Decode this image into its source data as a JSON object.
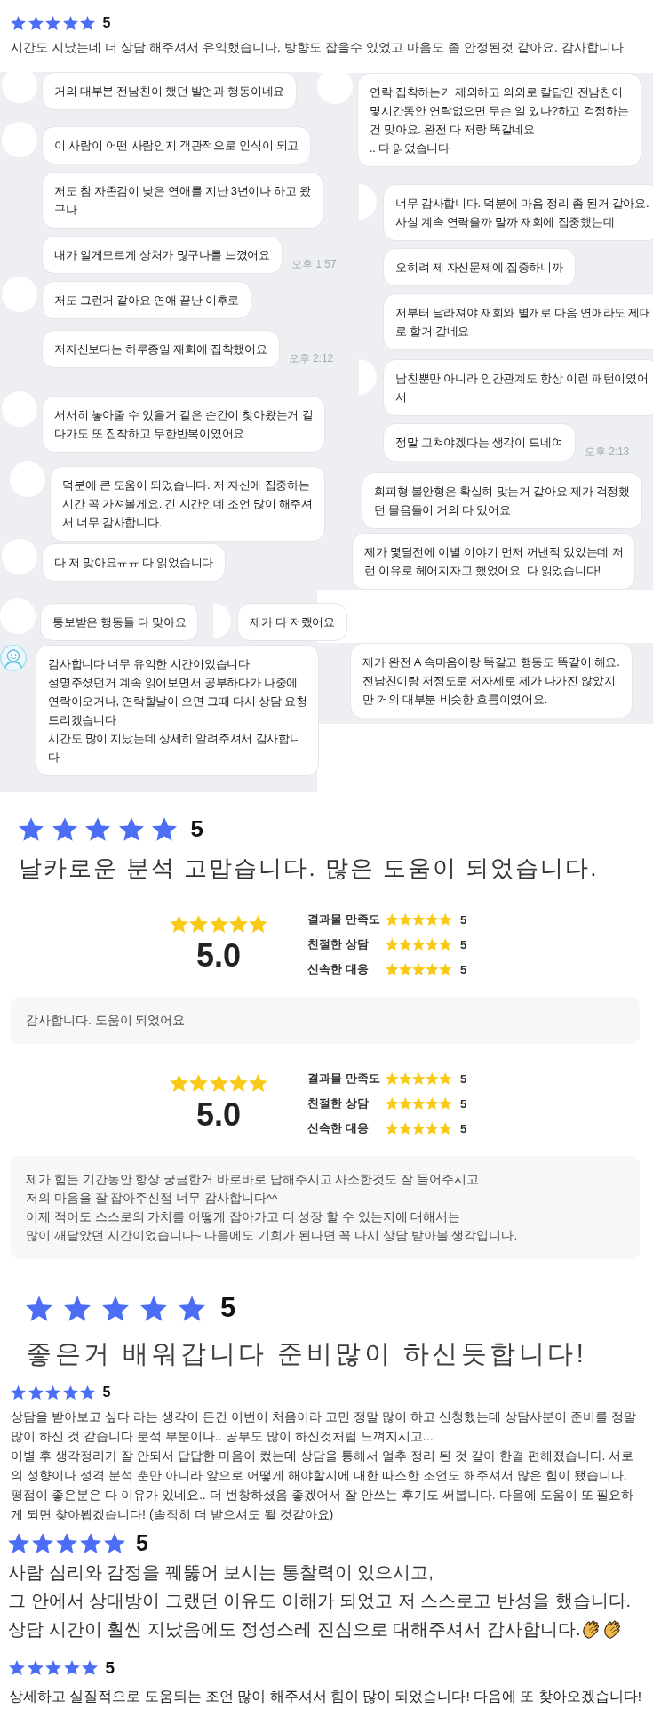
{
  "sections": [
    {
      "kind": "compact_review",
      "stars": 5,
      "score": "5",
      "text": "시간도 지났는데 더 상담 해주셔서 유익했습니다. 방향도 잡을수 있었고 마음도 좀 안정된것 같아요. 감사합니다"
    },
    {
      "kind": "chat_collage",
      "columns": [
        {
          "panels": [
            {
              "messages": [
                {
                  "kind": "avatar_message",
                  "text": "거의 대부분 전남친이 했던 발언과 행동이네요"
                },
                {
                  "kind": "avatar_message",
                  "text": "이 사람이 어떤 사람인지 객관적으로 인식이 되고"
                },
                {
                  "kind": "plain_message",
                  "text": "저도 참 자존감이 낮은 연애를 지난 3년이나 하고 왔\n구나"
                },
                {
                  "kind": "plain_message",
                  "text": "내가 알게모르게 상처가 많구나를 느꼈어요",
                  "time": "오후 1:57"
                },
                {
                  "kind": "avatar_message",
                  "text": "저도 그런거 같아요 연애 끝난 이후로"
                },
                {
                  "kind": "plain_message",
                  "text": "저자신보다는 하루종일 재회에 집착했어요",
                  "time": "오후 2:12"
                },
                {
                  "kind": "avatar_message",
                  "text": "서서히 놓아줄 수 있을거 같은 순간이 찾아왔는거 같\n다가도 또 집착하고 무한반복이였어요"
                },
                {
                  "kind": "avatar_message",
                  "text": "덕분에 큰 도움이 되었습니다. 저 자신에 집중하는\n시간 꼭 가져볼게요. 긴 시간인데 조언 많이 해주셔\n서 너무 감사합니다."
                },
                {
                  "kind": "avatar_message",
                  "text": "다 저 맞아요ㅠㅠ 다 읽었습니다"
                },
                {
                  "kind": "avatar_message",
                  "text": "통보받은 행동들 다 맞아요"
                },
                {
                  "kind": "cropped_avatar_message",
                  "text": "제가 다 저랬어요"
                },
                {
                  "kind": "profile_message",
                  "text": "감사합니다 너무 유익한 시간이었습니다\n설명주셨던거 계속 읽어보면서 공부하다가 나중에\n연락이오거나, 연락할날이 오면 그때 다시 상담 요청\n드리겠습니다\n시간도 많이 지났는데 상세히 알려주셔서 감사합니\n다"
                }
              ]
            }
          ]
        },
        {
          "panels": [
            {
              "messages": [
                {
                  "kind": "avatar_message",
                  "text": "연락 집착하는거 제외하고 의외로 칼답인 전남친이\n몇시간동안 연락없으면 무슨 일 있나?하고 걱정하는\n건 맞아요. 완전 다 저랑 똑같네요\n.. 다 읽었습니다"
                },
                {
                  "kind": "cropped_avatar_message",
                  "text": "너무 감사합니다. 덕분에 마음 정리 좀 된거 같아요.\n사실 계속 연락올까 말까 재회에 집중했는데"
                },
                {
                  "kind": "plain_message",
                  "text": "오히려 제 자신문제에 집중하니까"
                },
                {
                  "kind": "plain_message",
                  "text": "저부터 달라져야 재회와 별개로 다음 연애라도 제대\n로 할거 갈네요"
                },
                {
                  "kind": "cropped_avatar_message",
                  "text": "남친뿐만 아니라 인간관계도 항상 이런 패턴이였어\n서"
                },
                {
                  "kind": "plain_message",
                  "text": "정말 고쳐야겠다는 생각이 드네여",
                  "time": "오후 2:13"
                },
                {
                  "kind": "plain_message",
                  "text": "회피형 불안형은 확실히 맞는거 같아요 제가 걱정했\n던 물음들이 거의 다 있어요"
                },
                {
                  "kind": "plain_message",
                  "text": "제가 몇달전에 이별 이야기 먼저 꺼낸적 있었는데 저\n런 이유로 헤어지자고 했었어요. 다 읽었습니다!"
                }
              ]
            },
            {
              "messages": [
                {
                  "kind": "plain_message",
                  "text": "제가 완전 A 속마음이랑 똑같고 행동도 똑같이 해요.\n전남친이랑 저정도로 저자세로 제가 나가진 않았지\n만 거의 대부분 비슷한 흐름이였어요."
                }
              ]
            }
          ]
        }
      ]
    },
    {
      "kind": "headline_review",
      "stars": 5,
      "score": "5",
      "text": "날카로운 분석 고맙습니다. 많은 도움이 되었습니다."
    },
    {
      "kind": "rating_card",
      "stars": 5,
      "score": "5.0",
      "criteria": [
        {
          "label": "결과물 만족도",
          "stars": 5,
          "score": "5"
        },
        {
          "label": "친절한 상담",
          "stars": 5,
          "score": "5"
        },
        {
          "label": "신속한 대응",
          "stars": 5,
          "score": "5"
        }
      ],
      "comment": "감사합니다. 도움이 되었어요"
    },
    {
      "kind": "rating_card",
      "stars": 5,
      "score": "5.0",
      "criteria": [
        {
          "label": "결과물 만족도",
          "stars": 5,
          "score": "5"
        },
        {
          "label": "친절한 상담",
          "stars": 5,
          "score": "5"
        },
        {
          "label": "신속한 대응",
          "stars": 5,
          "score": "5"
        }
      ],
      "comment": "제가 힘든 기간동안 항상 궁금한거 바로바로 답해주시고 사소한것도 잘 들어주시고\n저의 마음을 잘 잡아주신점 너무 감사합니다^^\n이제 적어도 스스로의 가치를 어떻게 잡아가고 더 성장 할 수 있는지에 대해서는\n많이 깨달았던 시간이었습니다~ 다음에도 기회가 된다면 꼭 다시 상담 받아볼 생각입니다."
    },
    {
      "kind": "banner_review",
      "stars": 5,
      "score": "5",
      "text": "좋은거 배워갑니다 준비많이 하신듯합니다!"
    },
    {
      "kind": "compact_review",
      "stars": 5,
      "score": "5",
      "text": "상담을 받아보고 싶다 라는 생각이 든건 이번이 처음이라 고민 정말 많이 하고 신청했는데 상담사분이 준비를 정말 많이 하신 것 같습니다 분석 부분이나.. 공부도 많이 하신것처럼 느껴지시고...\n이별 후 생각정리가 잘 안되서 답답한 마음이 컸는데 상담을 통해서 얼추 정리 된 것 같아 한결 편해졌습니다. 서로의 성향이나 성격 분석 뿐만 아니라 앞으로 어떻게 해야할지에 대한 따스한 조언도 해주셔서 많은 힘이 됐습니다.\n평점이 좋은분은 다 이유가 있네요.. 더 번창하셨음 좋겠어서 잘 안쓰는 후기도 써봅니다. 다음에 도움이 또 필요하게 되면 찾아뵙겠습니다! (솔직히 더 받으셔도 될 것같아요)"
    },
    {
      "kind": "large_review",
      "stars": 5,
      "score": "5",
      "lines": [
        "사람 심리와 감정을 꿰뚫어 보시는 통찰력이 있으시고,",
        "그 안에서 상대방이 그랬던 이유도 이해가 되었고 저 스스로고 반성을 했습니다.",
        "상담 시간이 훨씬 지났음에도 정성스레 진심으로 대해주셔서 감사합니다."
      ],
      "has_emoji": true
    },
    {
      "kind": "medium_review",
      "stars": 5,
      "score": "5",
      "text": "상세하고 실질적으로 도움되는 조언 많이 해주셔서 힘이 많이 되었습니다! 다음에 또 찾아오겠습니다!"
    }
  ]
}
